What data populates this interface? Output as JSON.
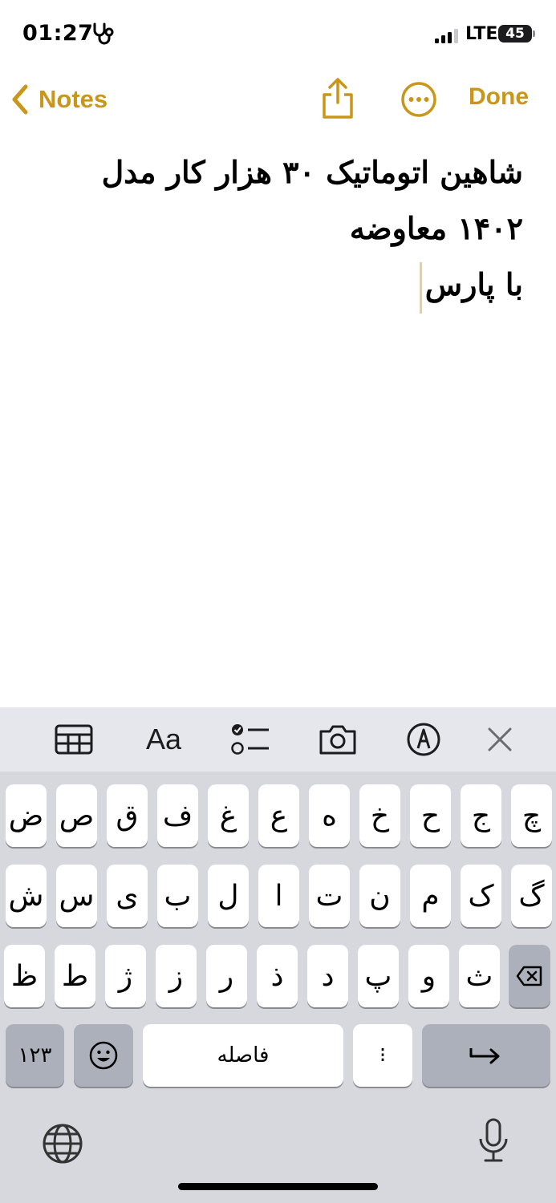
{
  "status": {
    "time": "01:27",
    "network": "LTE",
    "battery": "45"
  },
  "nav": {
    "back_label": "Notes",
    "done_label": "Done"
  },
  "note": {
    "line1": "شاهین اتوماتیک ۳۰ هزار کار مدل ۱۴۰۲ معاوضه",
    "line2": "با پارس"
  },
  "keyboard": {
    "row1": [
      "چ",
      "ج",
      "ح",
      "خ",
      "ه",
      "ع",
      "غ",
      "ف",
      "ق",
      "ص",
      "ض"
    ],
    "row2": [
      "گ",
      "ک",
      "م",
      "ن",
      "ت",
      "ا",
      "ل",
      "ب",
      "ی",
      "س",
      "ش"
    ],
    "row3": [
      "ث",
      "و",
      "پ",
      "د",
      "ذ",
      "ر",
      "ز",
      "ژ",
      "ط",
      "ظ"
    ],
    "numbers_label": "۱۲۳",
    "space_label": "فاصله",
    "punct_label": "⁝"
  },
  "colors": {
    "accent": "#c9961a",
    "keyboard_bg": "#d6d8de",
    "toolbar_bg": "#e6e7ec"
  }
}
